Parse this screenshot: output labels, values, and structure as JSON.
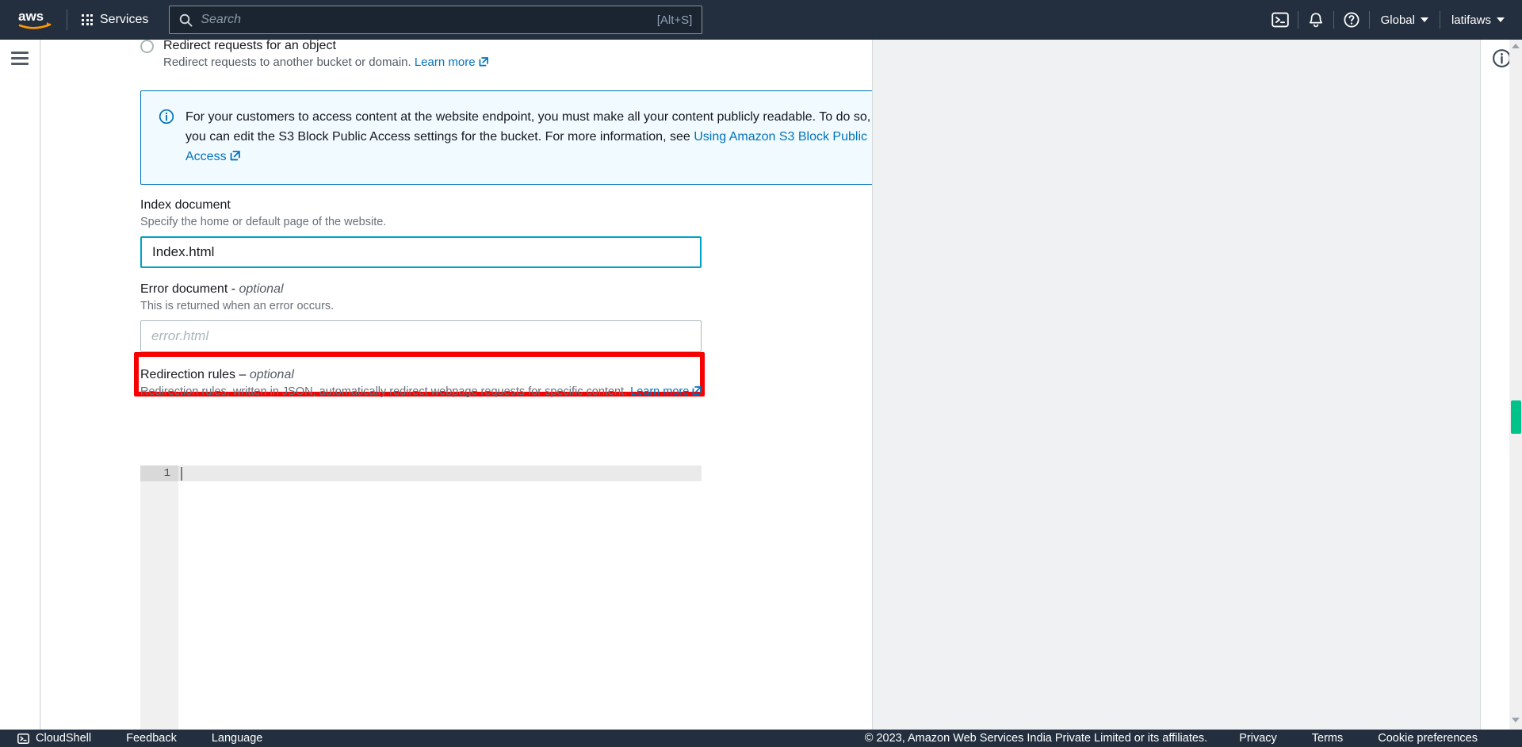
{
  "topnav": {
    "logo_alt": "aws",
    "services_label": "Services",
    "search_placeholder": "Search",
    "search_value": "",
    "search_shortcut": "[Alt+S]",
    "cloudshell_icon": "cloudshell-icon",
    "notifications_icon": "bell-icon",
    "help_icon": "help-circle-icon",
    "region_label": "Global",
    "account_label": "latifaws"
  },
  "left_rail": {
    "menu_icon": "hamburger-menu-icon"
  },
  "right_rail": {
    "info_icon": "info-circle-icon"
  },
  "form": {
    "cutoff_option": {
      "label": "Redirect requests for an object",
      "description": "Redirect requests to another bucket or domain.",
      "link_label": "Learn more"
    },
    "alert": {
      "icon": "info-circle-icon",
      "text": "For your customers to access content at the website endpoint, you must make all your content publicly readable. To do so, you can edit the S3 Block Public Access settings for the bucket. For more information, see",
      "link_label": "Using Amazon S3 Block Public Access"
    },
    "index_document": {
      "label": "Index document",
      "description": "Specify the home or default page of the website.",
      "value": "Index.html",
      "placeholder": "index.html"
    },
    "error_document": {
      "label": "Error document - ",
      "label_optional": "optional",
      "description": "This is returned when an error occurs.",
      "value": "",
      "placeholder": "error.html",
      "highlight_color": "#f70000"
    },
    "redirection_rules": {
      "label": "Redirection rules – ",
      "label_optional": "optional",
      "description": "Redirection rules, written in JSON, automatically redirect webpage requests for specific content.",
      "link_label": "Learn more",
      "editor_line_number": "1",
      "editor_value": ""
    }
  },
  "scrollbar": {
    "thumb_color": "#00c389"
  },
  "footer": {
    "cloudshell_label": "CloudShell",
    "cloudshell_icon": "cloudshell-icon",
    "feedback_label": "Feedback",
    "language_label": "Language",
    "copyright": "© 2023, Amazon Web Services India Private Limited or its affiliates.",
    "privacy_label": "Privacy",
    "terms_label": "Terms",
    "cookie_label": "Cookie preferences"
  }
}
